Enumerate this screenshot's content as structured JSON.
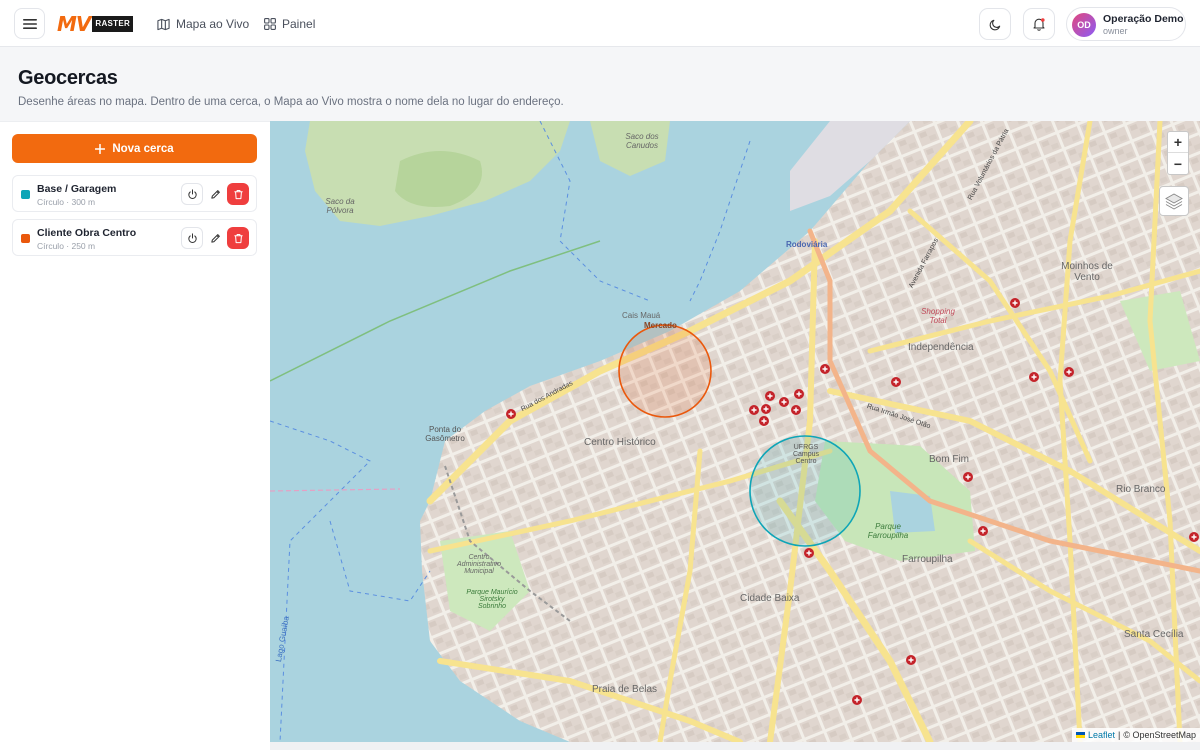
{
  "header": {
    "logo_text": "MV",
    "logo_badge": "RASTER",
    "nav": [
      {
        "label": "Mapa ao Vivo",
        "icon": "map-icon"
      },
      {
        "label": "Painel",
        "icon": "dashboard-icon"
      }
    ],
    "user": {
      "initials": "OD",
      "name": "Operação Demo",
      "role": "owner"
    }
  },
  "page": {
    "title": "Geocercas",
    "subtitle": "Desenhe áreas no mapa. Dentro de uma cerca, o Mapa ao Vivo mostra o nome dela no lugar do endereço."
  },
  "sidebar": {
    "new_button": "Nova cerca",
    "fences": [
      {
        "name": "Base / Garagem",
        "meta": "Círculo · 300 m",
        "color": "#0ea5b7"
      },
      {
        "name": "Cliente Obra Centro",
        "meta": "Círculo · 250 m",
        "color": "#ea580c"
      }
    ]
  },
  "map": {
    "zoom_in": "+",
    "zoom_out": "−",
    "attribution_leaflet": "Leaflet",
    "attribution_sep": "|",
    "attribution_osm": "© OpenStreetMap",
    "labels": {
      "centro_historico": "Centro Histórico",
      "independencia": "Independência",
      "bom_fim": "Bom Fim",
      "farroupilha": "Farroupilha",
      "cidade_baixa": "Cidade Baixa",
      "rio_branco": "Rio Branco",
      "moinhos": "Moinhos de Vento",
      "praia_de_belas": "Praia de Belas",
      "santa_cecilia": "Santa Cecília",
      "rodoviaria": "Rodoviária",
      "mercado": "Mercado",
      "cais_maua": "Cais Mauá",
      "saco_polvora": "Saco da Pólvora",
      "saco_canudos": "Saco dos Canudos",
      "ponta_gasometro": "Ponta do Gasômetro",
      "lago_guaiba": "Lago Guaíba",
      "parque_farroupilha": "Parque Farroupilha",
      "ufrgs_centro": "UFRGS Campus Centro",
      "shopping_total": "Shopping Total",
      "centro_admin": "Centro Administrativo Municipal",
      "parque_sirotsky": "Parque Maurício Sirotsky Sobrinho",
      "rua_andradas": "Rua dos Andradas",
      "rua_irmao_jose_otao": "Rua Irmão José Otão",
      "avenida_farrapos": "Avenida Farrapos",
      "rua_voluntarios": "Rua Voluntários da Pátria"
    }
  },
  "colors": {
    "accent": "#f26a0f",
    "danger": "#ef3e3e",
    "fence_teal": "#0ea5b7",
    "fence_orange": "#ea580c"
  }
}
